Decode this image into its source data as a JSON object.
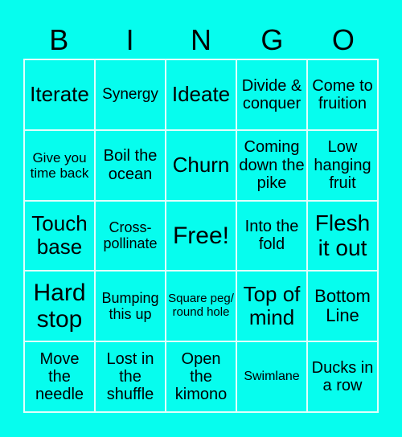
{
  "header": [
    "B",
    "I",
    "N",
    "G",
    "O"
  ],
  "colors": {
    "background": "#06fdee",
    "grid_line": "#e0fffc",
    "text": "#000000"
  },
  "cells": [
    {
      "text": "Iterate",
      "size": 26
    },
    {
      "text": "Synergy",
      "size": 19
    },
    {
      "text": "Ideate",
      "size": 26
    },
    {
      "text": "Divide & conquer",
      "size": 20
    },
    {
      "text": "Come to fruition",
      "size": 20
    },
    {
      "text": "Give you time back",
      "size": 17
    },
    {
      "text": "Boil the ocean",
      "size": 20
    },
    {
      "text": "Churn",
      "size": 26
    },
    {
      "text": "Coming down the pike",
      "size": 20
    },
    {
      "text": "Low hanging fruit",
      "size": 20
    },
    {
      "text": "Touch base",
      "size": 26
    },
    {
      "text": "Cross-pollinate",
      "size": 18
    },
    {
      "text": "Free!",
      "size": 30
    },
    {
      "text": "Into the fold",
      "size": 20
    },
    {
      "text": "Flesh it out",
      "size": 28
    },
    {
      "text": "Hard stop",
      "size": 30
    },
    {
      "text": "Bumping this up",
      "size": 18
    },
    {
      "text": "Square peg/ round hole",
      "size": 15
    },
    {
      "text": "Top of mind",
      "size": 26
    },
    {
      "text": "Bottom Line",
      "size": 22
    },
    {
      "text": "Move the needle",
      "size": 20
    },
    {
      "text": "Lost in the shuffle",
      "size": 20
    },
    {
      "text": "Open the kimono",
      "size": 20
    },
    {
      "text": "Swimlane",
      "size": 16
    },
    {
      "text": "Ducks in a row",
      "size": 20
    }
  ]
}
